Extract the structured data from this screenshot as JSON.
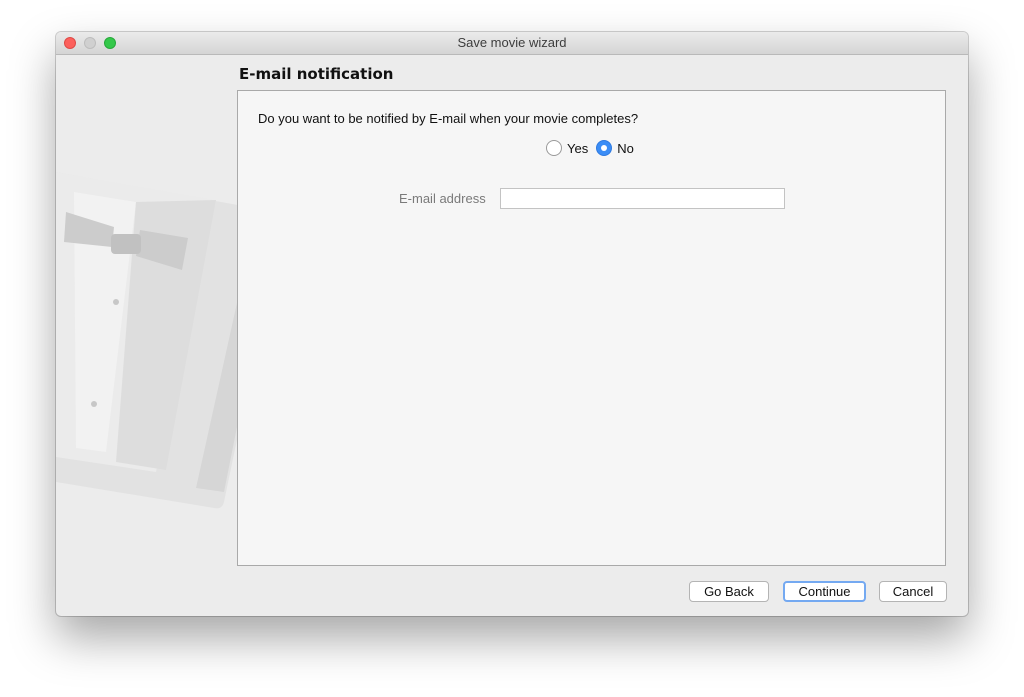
{
  "window": {
    "title": "Save movie wizard"
  },
  "heading": "E-mail notification",
  "question": "Do you want to be notified by E-mail when your movie completes?",
  "notify_options": {
    "yes_label": "Yes",
    "no_label": "No",
    "selected": "No"
  },
  "email": {
    "label": "E-mail address",
    "value": ""
  },
  "buttons": {
    "back": "Go Back",
    "continue": "Continue",
    "cancel": "Cancel"
  },
  "colors": {
    "accent": "#3b8df6",
    "close": "#fc605c",
    "maximize": "#34c84a"
  }
}
